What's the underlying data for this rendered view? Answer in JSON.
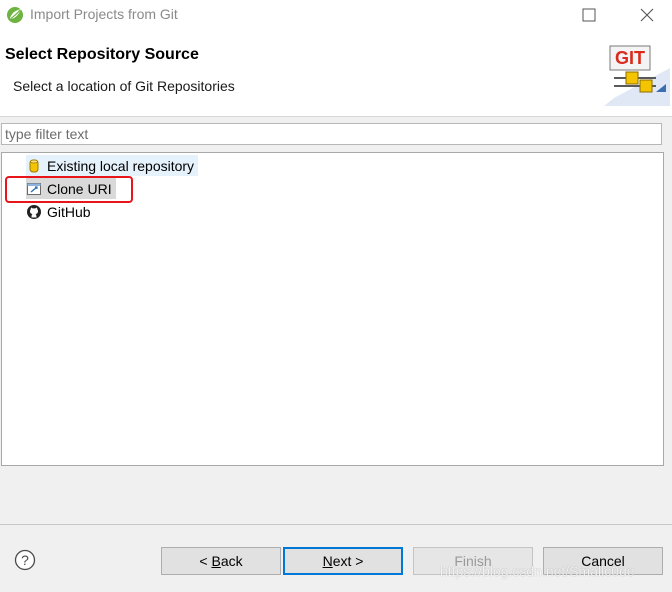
{
  "window": {
    "title": "Import Projects from Git"
  },
  "header": {
    "title": "Select Repository Source",
    "subtitle": "Select a location of Git Repositories",
    "logo_text": "GIT"
  },
  "filter": {
    "placeholder": "type filter text",
    "value": ""
  },
  "sources": [
    {
      "label": "Existing local repository",
      "icon": "database-icon",
      "state": "hover"
    },
    {
      "label": "Clone URI",
      "icon": "clone-uri-icon",
      "state": "selected"
    },
    {
      "label": "GitHub",
      "icon": "github-icon",
      "state": "normal"
    }
  ],
  "buttons": {
    "back_prefix": "< ",
    "back_mnemonic": "B",
    "back_rest": "ack",
    "next_mnemonic": "N",
    "next_rest": "ext >",
    "finish": "Finish",
    "cancel": "Cancel"
  },
  "watermark": "https://blog.csdn.net/Smallc0de",
  "colors": {
    "highlight_box": "#e8151b",
    "default_button_border": "#0078d7",
    "hover_row": "#e5f1fb",
    "selected_row": "#d9d9d9"
  }
}
